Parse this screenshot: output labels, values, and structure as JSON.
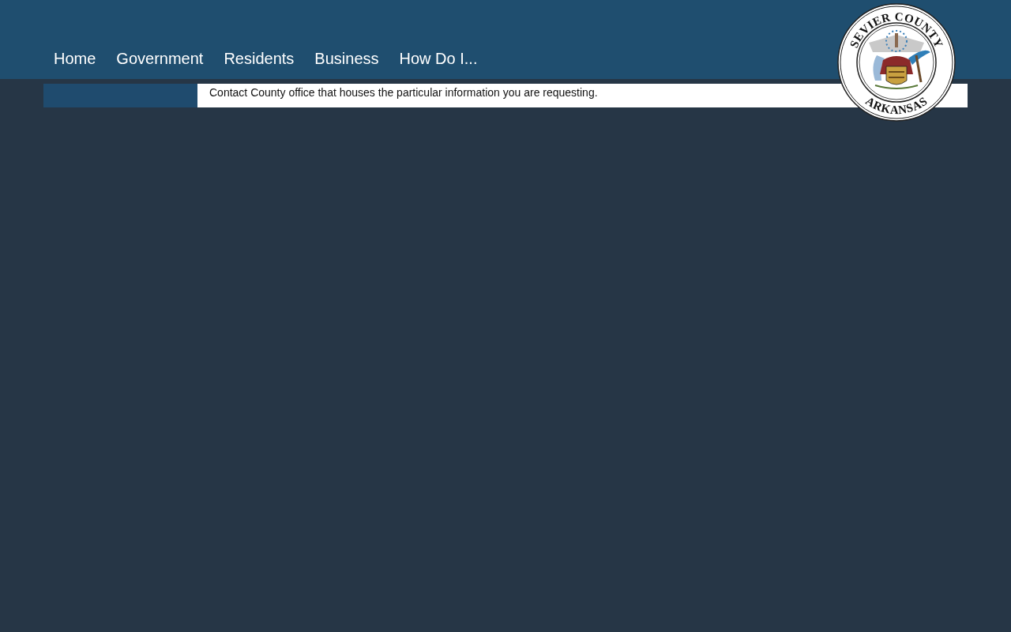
{
  "nav": [
    {
      "label": "Home"
    },
    {
      "label": "Government"
    },
    {
      "label": "Residents"
    },
    {
      "label": "Business"
    },
    {
      "label": "How Do I..."
    }
  ],
  "seal": {
    "top_text": "SEVIER COUNTY",
    "bottom_text": "ARKANSAS"
  },
  "content": {
    "text": "Contact County office that houses the particular information you are requesting."
  }
}
